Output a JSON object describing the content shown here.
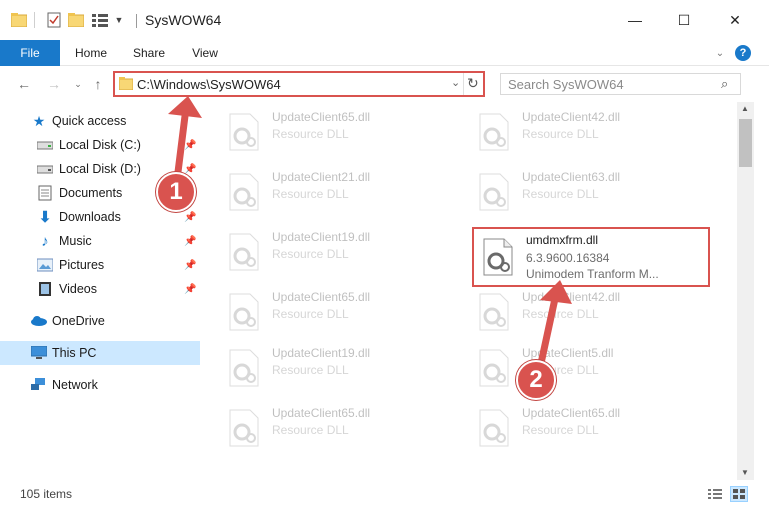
{
  "window": {
    "title": "SysWOW64",
    "controls": {
      "minimize": "—",
      "maximize": "☐",
      "close": "✕"
    }
  },
  "ribbon": {
    "tabs": [
      "File",
      "Home",
      "Share",
      "View"
    ],
    "expand_icon": "chevron-down-icon",
    "help_icon": "help-icon"
  },
  "nav": {
    "address": "C:\\Windows\\SysWOW64",
    "search_placeholder": "Search SysWOW64"
  },
  "sidebar": {
    "items": [
      {
        "label": "Quick access",
        "icon": "star-icon",
        "pinned": false
      },
      {
        "label": "Local Disk (C:)",
        "icon": "drive-icon",
        "pinned": true
      },
      {
        "label": "Local Disk (D:)",
        "icon": "drive-icon",
        "pinned": true
      },
      {
        "label": "Documents",
        "icon": "documents-icon",
        "pinned": true
      },
      {
        "label": "Downloads",
        "icon": "download-icon",
        "pinned": true
      },
      {
        "label": "Music",
        "icon": "music-icon",
        "pinned": true
      },
      {
        "label": "Pictures",
        "icon": "pictures-icon",
        "pinned": true
      },
      {
        "label": "Videos",
        "icon": "videos-icon",
        "pinned": true
      },
      {
        "label": "OneDrive",
        "icon": "cloud-icon",
        "pinned": false
      },
      {
        "label": "This PC",
        "icon": "computer-icon",
        "pinned": false,
        "selected": true
      },
      {
        "label": "Network",
        "icon": "network-icon",
        "pinned": false
      }
    ]
  },
  "files": [
    {
      "name": "UpdateClient65.dll",
      "type": "Resource DLL",
      "faded": true
    },
    {
      "name": "UpdateClient42.dll",
      "type": "Resource DLL",
      "faded": true
    },
    {
      "name": "UpdateClient21.dll",
      "type": "Resource DLL",
      "faded": true
    },
    {
      "name": "UpdateClient63.dll",
      "type": "Resource DLL",
      "faded": true
    },
    {
      "name": "UpdateClient19.dll",
      "type": "Resource DLL",
      "faded": true
    },
    {
      "name": "umdmxfrm.dll",
      "type": "6.3.9600.16384",
      "desc": "Unimodem Tranform M...",
      "faded": false,
      "highlighted": true
    },
    {
      "name": "UpdateClient65.dll",
      "type": "Resource DLL",
      "faded": true
    },
    {
      "name": "UpdateClient42.dll",
      "type": "Resource DLL",
      "faded": true
    },
    {
      "name": "UpdateClient19.dll",
      "type": "Resource DLL",
      "faded": true
    },
    {
      "name": "UpdateClient5.dll",
      "type": "Resource DLL",
      "faded": true
    },
    {
      "name": "UpdateClient65.dll",
      "type": "Resource DLL",
      "faded": true
    },
    {
      "name": "UpdateClient65.dll",
      "type": "Resource DLL",
      "faded": true
    }
  ],
  "status": {
    "item_count": "105 items"
  },
  "callouts": [
    "1",
    "2"
  ],
  "colors": {
    "accent": "#1979ca",
    "highlight": "#d9534f",
    "selected": "#cce8ff"
  }
}
